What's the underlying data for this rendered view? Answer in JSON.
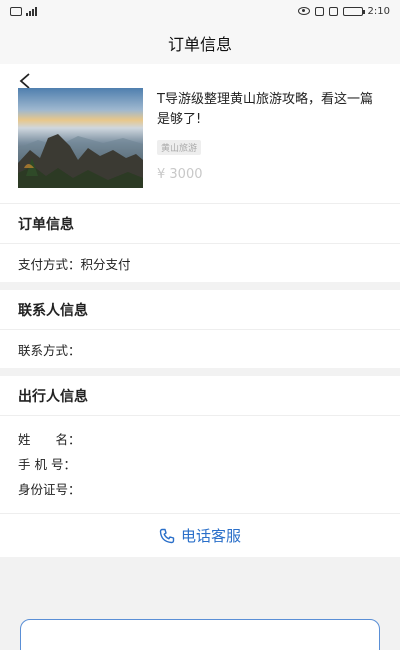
{
  "status_bar": {
    "time": "2:10",
    "left_icons": [
      "sim-icon",
      "signal-icon"
    ],
    "right_icons": [
      "eye-icon",
      "nfc-icon",
      "vibrate-icon",
      "battery-icon"
    ]
  },
  "header": {
    "title": "订单信息"
  },
  "product": {
    "title": "T导游级整理黄山旅游攻略，看这一篇是够了!",
    "tag": "黄山旅游",
    "price": "¥ 3000"
  },
  "order_info": {
    "heading": "订单信息",
    "payment_label": "支付方式：",
    "payment_value": "积分支付"
  },
  "contact_info": {
    "heading": "联系人信息",
    "contact_label": "联系方式："
  },
  "traveler_info": {
    "heading": "出行人信息",
    "name_label": "姓　　名：",
    "phone_label": "手 机 号：",
    "id_label": "身份证号："
  },
  "service": {
    "label": "电话客服",
    "icon": "phone-icon"
  },
  "colors": {
    "accent": "#2a6fc9",
    "button_border": "#5a8fd6"
  }
}
